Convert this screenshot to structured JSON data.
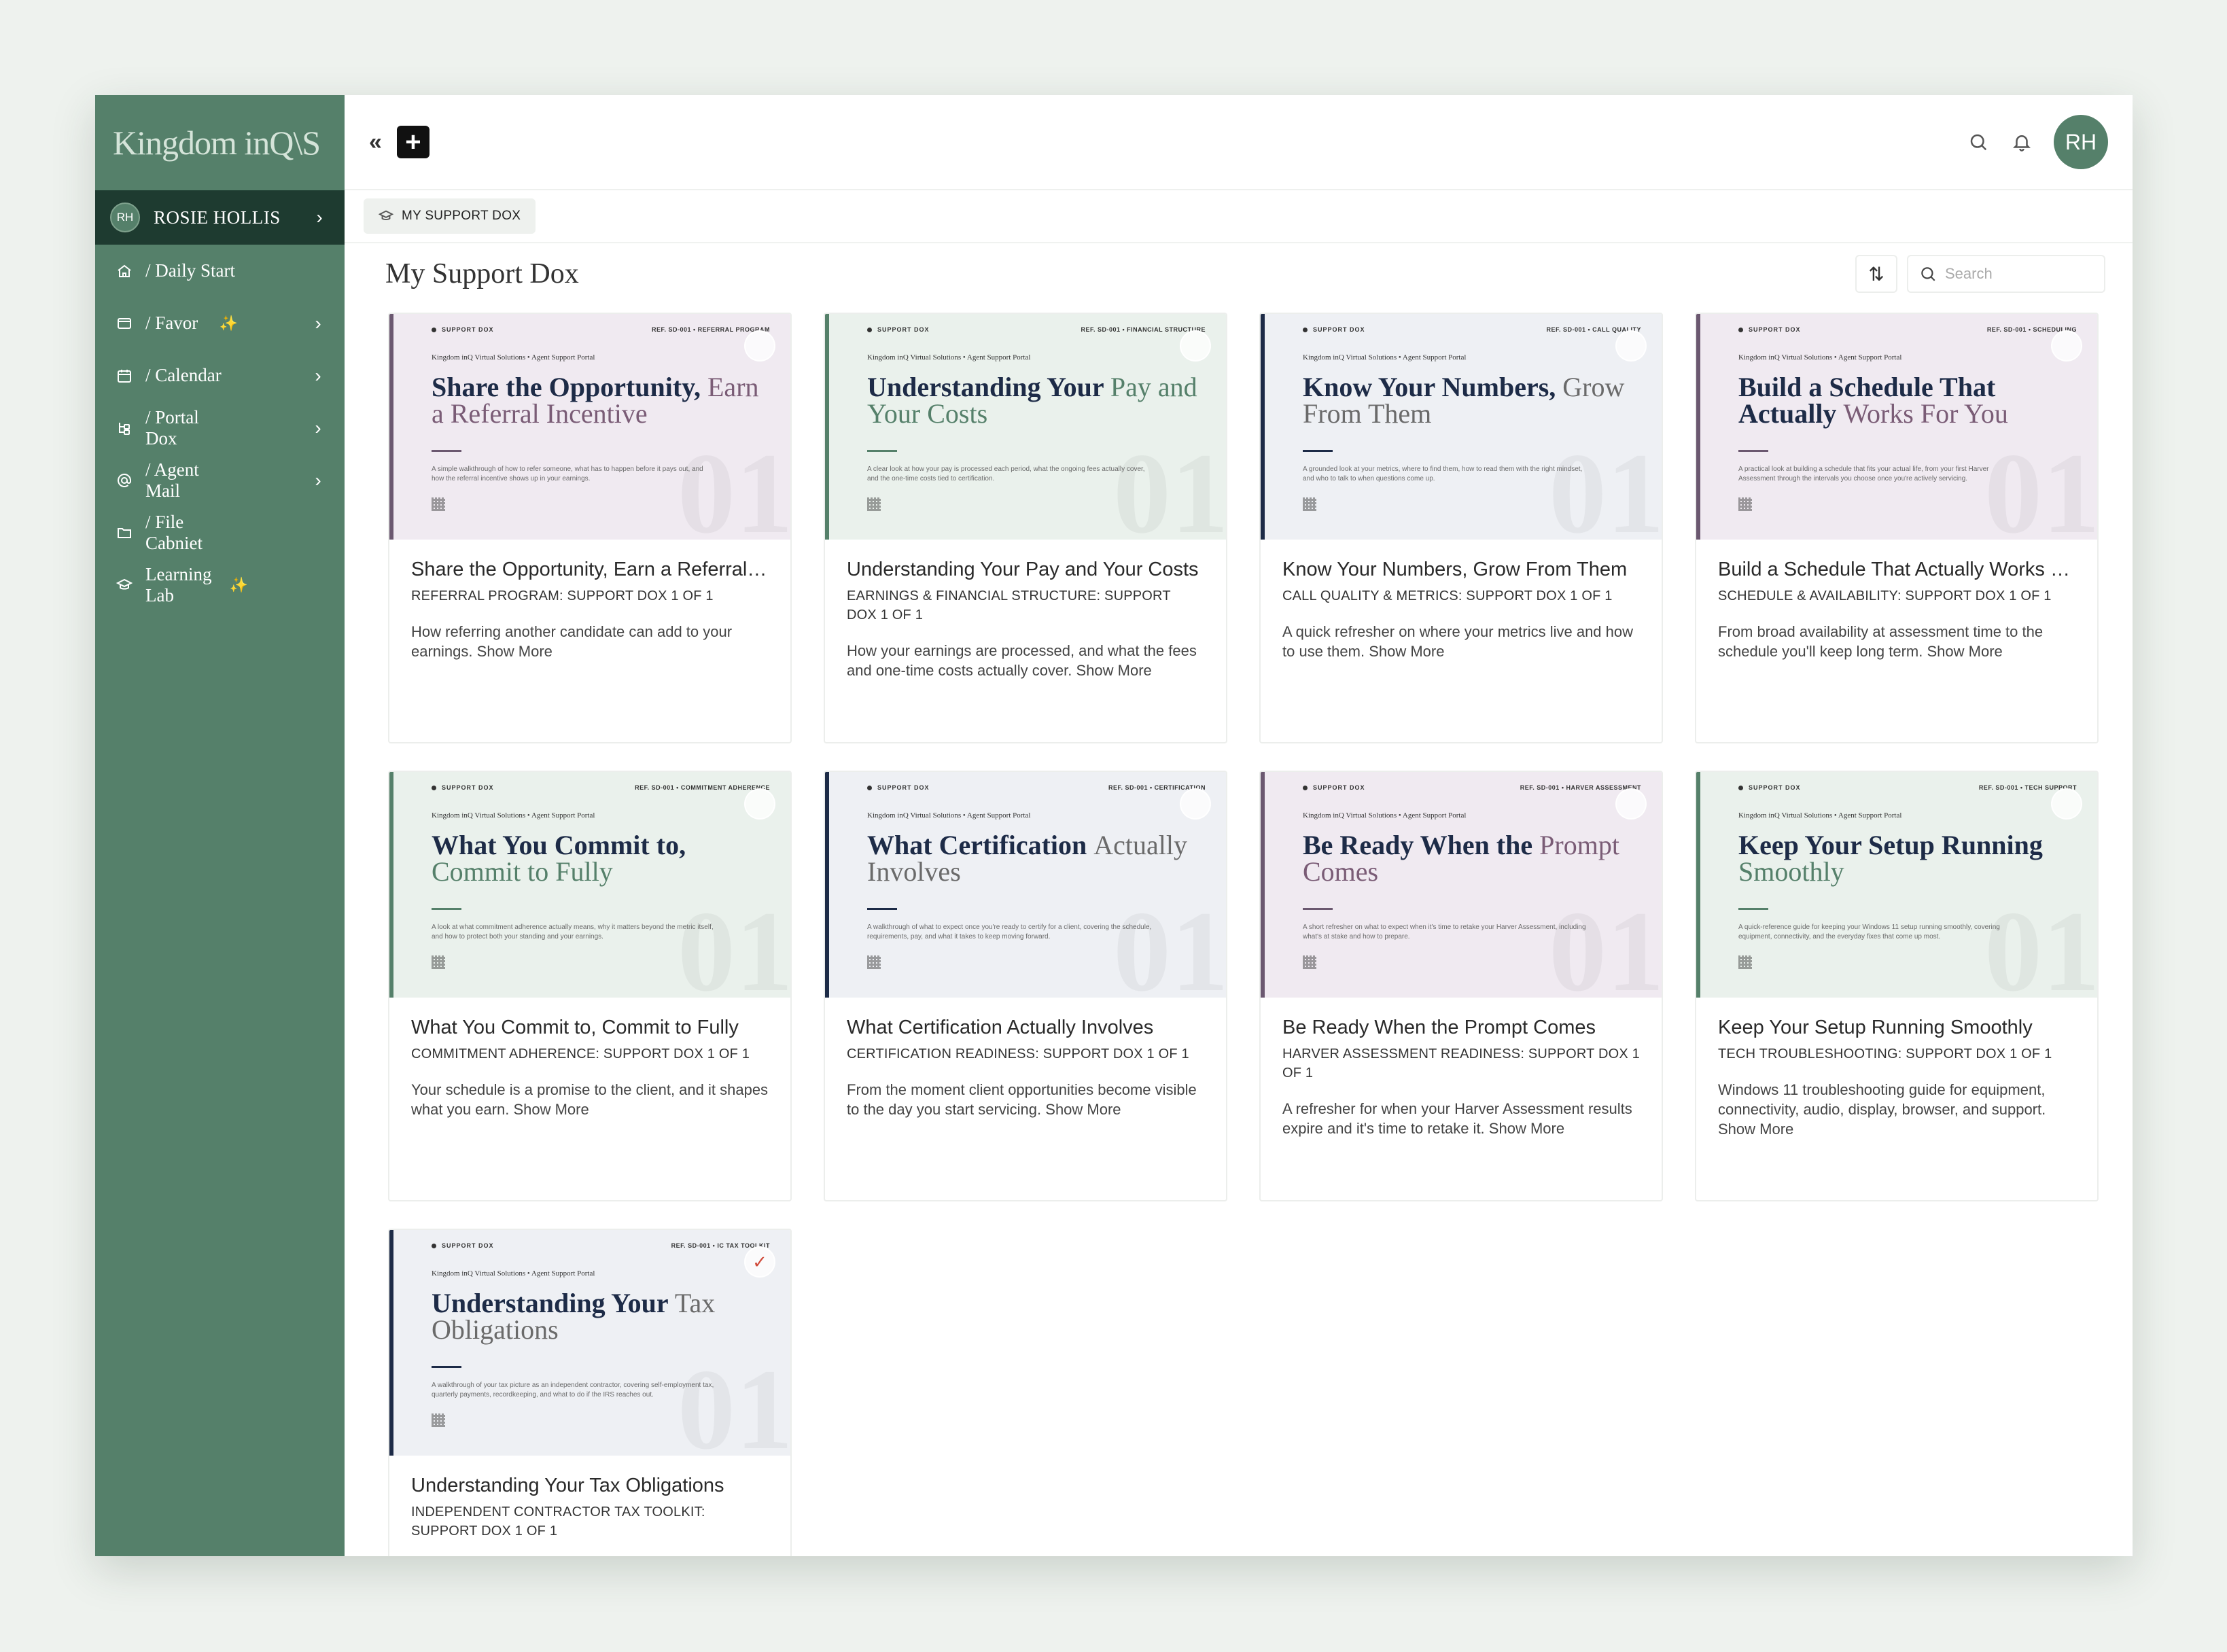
{
  "app": {
    "logo": "Kingdom inQ\\S",
    "user": {
      "initials": "RH",
      "name": "ROSIE HOLLIS"
    }
  },
  "sidebar": {
    "items": [
      {
        "label": "/ Daily Start",
        "icon": "home-icon",
        "has_chevron": false,
        "sparkle": false
      },
      {
        "label": "/ Favor",
        "icon": "window-icon",
        "has_chevron": true,
        "sparkle": true
      },
      {
        "label": "/ Calendar",
        "icon": "calendar-icon",
        "has_chevron": true,
        "sparkle": false
      },
      {
        "label": "/ Portal Dox",
        "icon": "tree-icon",
        "has_chevron": true,
        "sparkle": false
      },
      {
        "label": "/ Agent Mail",
        "icon": "at-icon",
        "has_chevron": true,
        "sparkle": false
      },
      {
        "label": "/ File Cabniet",
        "icon": "folder-icon",
        "has_chevron": false,
        "sparkle": false
      },
      {
        "label": "Learning Lab",
        "icon": "graduation-cap-icon",
        "has_chevron": false,
        "sparkle": true
      }
    ]
  },
  "topbar": {
    "collapse_label": "«",
    "new_label": "+",
    "avatar_initials": "RH"
  },
  "breadcrumb": {
    "label": "MY SUPPORT DOX"
  },
  "page": {
    "title": "My Support Dox",
    "sort_label": "⇅",
    "search_placeholder": "Search"
  },
  "thumb_common": {
    "tag": "SUPPORT DOX",
    "portal": "Kingdom inQ Virtual Solutions • Agent Support Portal",
    "number": "01"
  },
  "cards": [
    {
      "theme": "purple",
      "ref": "REF. SD-001 • REFERRAL PROGRAM",
      "thumb_title_main": "Share the Opportunity,",
      "thumb_title_accent": "Earn a Referral Incentive",
      "thumb_desc": "A simple walkthrough of how to refer someone, what has to happen before it pays out, and how the referral incentive shows up in your earnings.",
      "status": "",
      "title": "Share the Opportunity, Earn a Referral Incentive",
      "category": "REFERRAL PROGRAM: SUPPORT DOX 1 OF 1",
      "description": "How referring another candidate can add to your earnings.",
      "show_more": "Show More"
    },
    {
      "theme": "green",
      "ref": "REF. SD-001 • FINANCIAL STRUCTURE",
      "thumb_title_main": "Understanding Your",
      "thumb_title_accent": "Pay and Your Costs",
      "thumb_desc": "A clear look at how your pay is processed each period, what the ongoing fees actually cover, and the one-time costs tied to certification.",
      "status": "",
      "title": "Understanding Your Pay and Your Costs",
      "category": "EARNINGS & FINANCIAL STRUCTURE: SUPPORT DOX 1 OF 1",
      "description": "How your earnings are processed, and what the fees and one-time costs actually cover.",
      "show_more": "Show More"
    },
    {
      "theme": "navy",
      "ref": "REF. SD-001 • CALL QUALITY",
      "thumb_title_main": "Know Your Numbers,",
      "thumb_title_accent": "Grow From Them",
      "thumb_desc": "A grounded look at your metrics, where to find them, how to read them with the right mindset, and who to talk to when questions come up.",
      "status": "",
      "title": "Know Your Numbers, Grow From Them",
      "category": "CALL QUALITY & METRICS: SUPPORT DOX 1 OF 1",
      "description": "A quick refresher on where your metrics live and how to use them.",
      "show_more": "Show More"
    },
    {
      "theme": "purple",
      "ref": "REF. SD-001 • SCHEDULING",
      "thumb_title_main": "Build a Schedule That Actually",
      "thumb_title_accent": "Works For You",
      "thumb_desc": "A practical look at building a schedule that fits your actual life, from your first Harver Assessment through the intervals you choose once you're actively servicing.",
      "status": "",
      "title": "Build a Schedule That Actually Works For You",
      "category": "SCHEDULE & AVAILABILITY: SUPPORT DOX 1 OF 1",
      "description": "From broad availability at assessment time to the schedule you'll keep long term.",
      "show_more": "Show More"
    },
    {
      "theme": "green",
      "ref": "REF. SD-001 • COMMITMENT ADHERENCE",
      "thumb_title_main": "What You Commit to,",
      "thumb_title_accent": "Commit to Fully",
      "thumb_desc": "A look at what commitment adherence actually means, why it matters beyond the metric itself, and how to protect both your standing and your earnings.",
      "status": "",
      "title": "What You Commit to, Commit to Fully",
      "category": "COMMITMENT ADHERENCE: SUPPORT DOX 1 OF 1",
      "description": "Your schedule is a promise to the client, and it shapes what you earn.",
      "show_more": "Show More"
    },
    {
      "theme": "navy",
      "ref": "REF. SD-001 • CERTIFICATION",
      "thumb_title_main": "What Certification",
      "thumb_title_accent": "Actually Involves",
      "thumb_desc": "A walkthrough of what to expect once you're ready to certify for a client, covering the schedule, requirements, pay, and what it takes to keep moving forward.",
      "status": "",
      "title": "What Certification Actually Involves",
      "category": "CERTIFICATION READINESS: SUPPORT DOX 1 OF 1",
      "description": "From the moment client opportunities become visible to the day you start servicing.",
      "show_more": "Show More"
    },
    {
      "theme": "purple",
      "ref": "REF. SD-001 • HARVER ASSESSMENT",
      "thumb_title_main": "Be Ready When the",
      "thumb_title_accent": "Prompt Comes",
      "thumb_desc": "A short refresher on what to expect when it's time to retake your Harver Assessment, including what's at stake and how to prepare.",
      "status": "",
      "title": "Be Ready When the Prompt Comes",
      "category": "HARVER ASSESSMENT READINESS: SUPPORT DOX 1 OF 1",
      "description": "A refresher for when your Harver Assessment results expire and it's time to retake it.",
      "show_more": "Show More"
    },
    {
      "theme": "green",
      "ref": "REF. SD-001 • TECH SUPPORT",
      "thumb_title_main": "Keep Your Setup Running",
      "thumb_title_accent": "Smoothly",
      "thumb_desc": "A quick-reference guide for keeping your Windows 11 setup running smoothly, covering equipment, connectivity, and the everyday fixes that come up most.",
      "status": "",
      "title": "Keep Your Setup Running Smoothly",
      "category": "TECH TROUBLESHOOTING: SUPPORT DOX 1 OF 1",
      "description": "Windows 11 troubleshooting guide for equipment, connectivity, audio, display, browser, and support.",
      "show_more": "Show More"
    },
    {
      "theme": "navy",
      "ref": "REF. SD-001 • IC TAX TOOLKIT",
      "thumb_title_main": "Understanding Your",
      "thumb_title_accent": "Tax Obligations",
      "thumb_desc": "A walkthrough of your tax picture as an independent contractor, covering self-employment tax, quarterly payments, recordkeeping, and what to do if the IRS reaches out.",
      "status": "✓",
      "title": "Understanding Your Tax Obligations",
      "category": "INDEPENDENT CONTRACTOR TAX TOOLKIT: SUPPORT DOX 1 OF 1",
      "description": "",
      "show_more": ""
    }
  ]
}
